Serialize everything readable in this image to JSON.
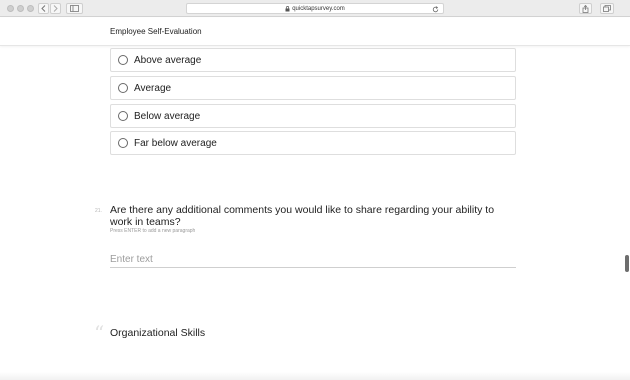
{
  "browser": {
    "url": "quicktapsurvey.com"
  },
  "header": {
    "title": "Employee Self-Evaluation"
  },
  "options": [
    {
      "label": "Above average"
    },
    {
      "label": "Average"
    },
    {
      "label": "Below average"
    },
    {
      "label": "Far below average"
    }
  ],
  "question": {
    "number": "21.",
    "text": "Are there any additional comments you would like to share regarding your ability to work in teams?",
    "hint": "Press ENTER to add a new paragraph",
    "input_placeholder": "Enter text",
    "input_value": ""
  },
  "section": {
    "title": "Organizational Skills",
    "icon": "quote-icon"
  },
  "colors": {
    "border": "#dedede",
    "text": "#222222",
    "placeholder": "#9d9d9d",
    "chrome": "#ececec"
  }
}
